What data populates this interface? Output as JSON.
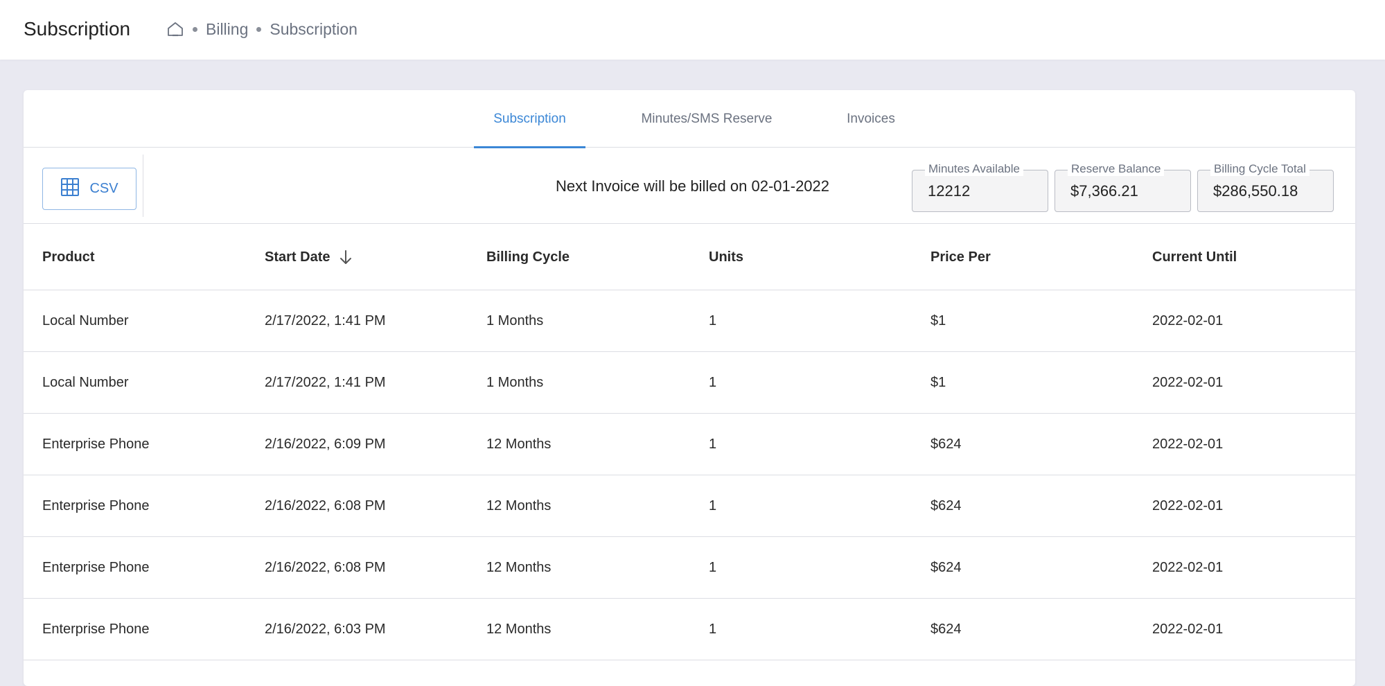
{
  "header": {
    "title": "Subscription",
    "breadcrumb": [
      "Billing",
      "Subscription"
    ]
  },
  "tabs": [
    {
      "label": "Subscription",
      "active": true
    },
    {
      "label": "Minutes/SMS Reserve",
      "active": false
    },
    {
      "label": "Invoices",
      "active": false
    }
  ],
  "toolbar": {
    "csv_label": "CSV",
    "next_invoice_text": "Next Invoice will be billed on 02-01-2022",
    "stats": [
      {
        "label": "Minutes Available",
        "value": "12212"
      },
      {
        "label": "Reserve Balance",
        "value": "$7,366.21"
      },
      {
        "label": "Billing Cycle Total",
        "value": "$286,550.18"
      }
    ]
  },
  "table": {
    "columns": [
      "Product",
      "Start Date",
      "Billing Cycle",
      "Units",
      "Price Per",
      "Current Until"
    ],
    "rows": [
      [
        "Local Number",
        "2/17/2022, 1:41 PM",
        "1 Months",
        "1",
        "$1",
        "2022-02-01"
      ],
      [
        "Local Number",
        "2/17/2022, 1:41 PM",
        "1 Months",
        "1",
        "$1",
        "2022-02-01"
      ],
      [
        "Enterprise Phone",
        "2/16/2022, 6:09 PM",
        "12 Months",
        "1",
        "$624",
        "2022-02-01"
      ],
      [
        "Enterprise Phone",
        "2/16/2022, 6:08 PM",
        "12 Months",
        "1",
        "$624",
        "2022-02-01"
      ],
      [
        "Enterprise Phone",
        "2/16/2022, 6:08 PM",
        "12 Months",
        "1",
        "$624",
        "2022-02-01"
      ],
      [
        "Enterprise Phone",
        "2/16/2022, 6:03 PM",
        "12 Months",
        "1",
        "$624",
        "2022-02-01"
      ]
    ]
  },
  "colors": {
    "accent": "#3b87d6",
    "background": "#e9e9f1"
  },
  "icons": {
    "home": "home-icon",
    "csv": "grid-icon",
    "sort": "arrow-down-icon"
  }
}
